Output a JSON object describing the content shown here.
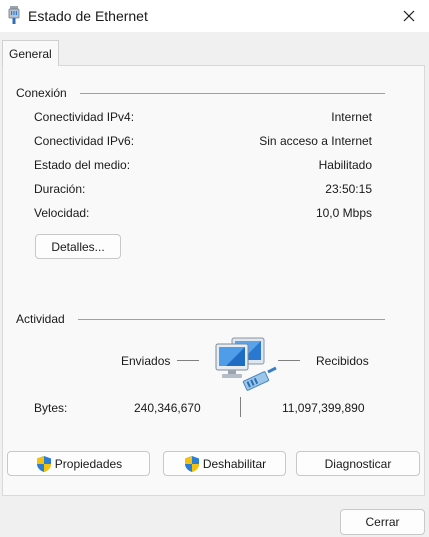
{
  "window": {
    "title": "Estado de Ethernet"
  },
  "tabs": [
    {
      "label": "General"
    }
  ],
  "connection": {
    "title": "Conexión",
    "rows": [
      {
        "label": "Conectividad IPv4:",
        "value": "Internet"
      },
      {
        "label": "Conectividad IPv6:",
        "value": "Sin acceso a Internet"
      },
      {
        "label": "Estado del medio:",
        "value": "Habilitado"
      },
      {
        "label": "Duración:",
        "value": "23:50:15"
      },
      {
        "label": "Velocidad:",
        "value": "10,0 Mbps"
      }
    ],
    "details_label": "Detalles..."
  },
  "activity": {
    "title": "Actividad",
    "sent_label": "Enviados",
    "received_label": "Recibidos",
    "bytes_label": "Bytes:",
    "bytes_sent": "240,346,670",
    "bytes_received": "11,097,399,890"
  },
  "buttons": {
    "properties": "Propiedades",
    "disable": "Deshabilitar",
    "diagnose": "Diagnosticar",
    "close": "Cerrar"
  },
  "icons": {
    "title": "ethernet-plug-icon",
    "close": "close-icon",
    "network": "network-computers-icon",
    "shield": "uac-shield-icon"
  },
  "colors": {
    "panel_bg": "#f9f9f9",
    "window_bg": "#f0f0f0",
    "accent_blue": "#2a7fd4",
    "shield_yellow": "#f4c20d"
  }
}
